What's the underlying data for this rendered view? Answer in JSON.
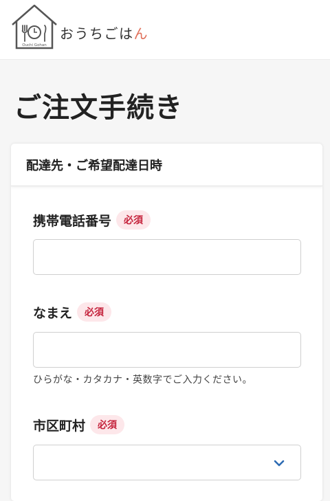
{
  "header": {
    "logo_text_main": "おうちごは",
    "logo_text_accent": "ん",
    "logo_subtext": "Ouchi Gohan"
  },
  "page_title": "ご注文手続き",
  "section": {
    "title": "配達先・ご希望配達日時"
  },
  "fields": {
    "phone": {
      "label": "携帯電話番号",
      "badge": "必須",
      "value": "",
      "placeholder": ""
    },
    "name": {
      "label": "なまえ",
      "badge": "必須",
      "value": "",
      "placeholder": "",
      "hint": "ひらがな・カタカナ・英数字でご入力ください。"
    },
    "city": {
      "label": "市区町村",
      "badge": "必須",
      "selected": ""
    }
  },
  "icons": {
    "logo": "house-plate-icon",
    "select_arrow": "chevron-down-icon"
  },
  "colors": {
    "badge_text": "#c5233c",
    "badge_bg": "#fde7ea",
    "chevron": "#2d6bb3",
    "logo_accent": "#e0705a"
  }
}
